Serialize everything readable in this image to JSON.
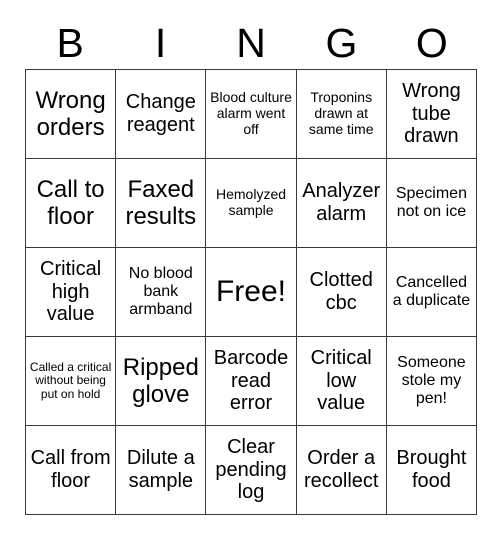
{
  "header": {
    "letters": [
      "B",
      "I",
      "N",
      "G",
      "O"
    ]
  },
  "grid": {
    "rows": [
      [
        {
          "text": "Wrong orders",
          "size": "lg"
        },
        {
          "text": "Change reagent",
          "size": "md"
        },
        {
          "text": "Blood culture alarm went off",
          "size": "xs"
        },
        {
          "text": "Troponins drawn at same time",
          "size": "xs"
        },
        {
          "text": "Wrong tube drawn",
          "size": "md"
        }
      ],
      [
        {
          "text": "Call to floor",
          "size": "lg"
        },
        {
          "text": "Faxed results",
          "size": "lg"
        },
        {
          "text": "Hemolyzed sample",
          "size": "xs"
        },
        {
          "text": "Analyzer alarm",
          "size": "md"
        },
        {
          "text": "Specimen not on ice",
          "size": "sm"
        }
      ],
      [
        {
          "text": "Critical high value",
          "size": "md"
        },
        {
          "text": "No blood bank armband",
          "size": "sm"
        },
        {
          "text": "Free!",
          "size": "xl"
        },
        {
          "text": "Clotted cbc",
          "size": "md"
        },
        {
          "text": "Cancelled a duplicate",
          "size": "sm"
        }
      ],
      [
        {
          "text": "Called a critical without being put on hold",
          "size": "xxs"
        },
        {
          "text": "Ripped glove",
          "size": "lg"
        },
        {
          "text": "Barcode read error",
          "size": "md"
        },
        {
          "text": "Critical low value",
          "size": "md"
        },
        {
          "text": "Someone stole my pen!",
          "size": "sm"
        }
      ],
      [
        {
          "text": "Call from floor",
          "size": "md"
        },
        {
          "text": "Dilute a sample",
          "size": "md"
        },
        {
          "text": "Clear pending log",
          "size": "md"
        },
        {
          "text": "Order a recollect",
          "size": "md"
        },
        {
          "text": "Brought food",
          "size": "md"
        }
      ]
    ]
  },
  "colors": {
    "border": "#3a3a3a",
    "text": "#000000",
    "background": "#ffffff"
  }
}
